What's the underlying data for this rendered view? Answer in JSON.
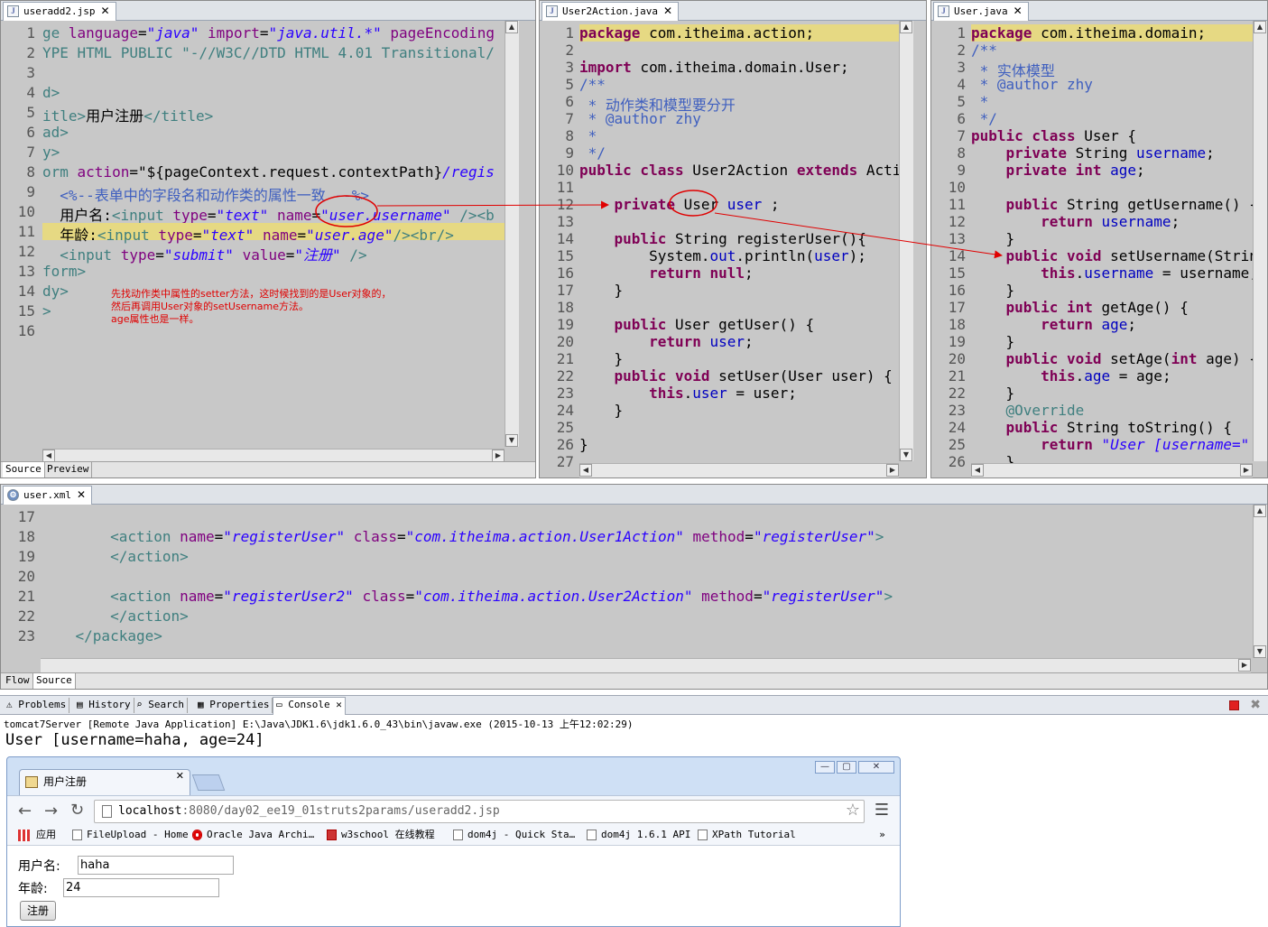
{
  "useradd": {
    "tab": "useradd2.jsp",
    "line_numbers": [
      "1",
      "2",
      "3",
      "4",
      "5",
      "6",
      "7",
      "8",
      "9",
      "10",
      "11",
      "12",
      "13",
      "14",
      "15",
      "16"
    ],
    "lines": [
      [
        {
          "t": "ge ",
          "c": "tag"
        },
        {
          "t": "language",
          "c": "attr"
        },
        {
          "t": "=",
          "c": ""
        },
        {
          "t": "\"java\"",
          "c": "str"
        },
        {
          "t": " ",
          "c": ""
        },
        {
          "t": "import",
          "c": "attr"
        },
        {
          "t": "=",
          "c": ""
        },
        {
          "t": "\"java.util.*\"",
          "c": "str"
        },
        {
          "t": " ",
          "c": ""
        },
        {
          "t": "pageEncoding",
          "c": "attr"
        }
      ],
      [
        {
          "t": "YPE HTML PUBLIC \"-//W3C//DTD HTML 4.01 Transitional/",
          "c": "tag"
        }
      ],
      [],
      [
        {
          "t": "d>",
          "c": "tag"
        }
      ],
      [
        {
          "t": "itle>",
          "c": "tag"
        },
        {
          "t": "用户注册",
          "c": ""
        },
        {
          "t": "</title>",
          "c": "tag"
        }
      ],
      [
        {
          "t": "ad>",
          "c": "tag"
        }
      ],
      [
        {
          "t": "y>",
          "c": "tag"
        }
      ],
      [
        {
          "t": "orm ",
          "c": "tag"
        },
        {
          "t": "action",
          "c": "attr"
        },
        {
          "t": "=\"${pageContext.request.contextPath}",
          "c": ""
        },
        {
          "t": "/regis",
          "c": "str"
        }
      ],
      [
        {
          "t": "  <%--表单中的字段名和动作类的属性一致 --%>",
          "c": "cm"
        }
      ],
      [
        {
          "t": "  用户名:",
          "c": ""
        },
        {
          "t": "<input ",
          "c": "tag"
        },
        {
          "t": "type",
          "c": "attr"
        },
        {
          "t": "=",
          "c": ""
        },
        {
          "t": "\"text\"",
          "c": "str"
        },
        {
          "t": " ",
          "c": ""
        },
        {
          "t": "name",
          "c": "attr"
        },
        {
          "t": "=",
          "c": ""
        },
        {
          "t": "\"user.username\"",
          "c": "str"
        },
        {
          "t": " />",
          "c": "tag"
        },
        {
          "t": "<b",
          "c": "tag"
        }
      ],
      [
        {
          "t": "  年龄:",
          "c": ""
        },
        {
          "t": "<input ",
          "c": "tag"
        },
        {
          "t": "type",
          "c": "attr"
        },
        {
          "t": "=",
          "c": ""
        },
        {
          "t": "\"text\"",
          "c": "str"
        },
        {
          "t": " ",
          "c": ""
        },
        {
          "t": "name",
          "c": "attr"
        },
        {
          "t": "=",
          "c": ""
        },
        {
          "t": "\"user.age\"",
          "c": "str"
        },
        {
          "t": "/><br/>",
          "c": "tag"
        }
      ],
      [
        {
          "t": "  <input ",
          "c": "tag"
        },
        {
          "t": "type",
          "c": "attr"
        },
        {
          "t": "=",
          "c": ""
        },
        {
          "t": "\"submit\"",
          "c": "str"
        },
        {
          "t": " ",
          "c": ""
        },
        {
          "t": "value",
          "c": "attr"
        },
        {
          "t": "=",
          "c": ""
        },
        {
          "t": "\"注册\"",
          "c": "str"
        },
        {
          "t": " />",
          "c": "tag"
        }
      ],
      [
        {
          "t": "form>",
          "c": "tag"
        }
      ],
      [
        {
          "t": "dy>",
          "c": "tag"
        }
      ],
      [
        {
          "t": ">",
          "c": "tag"
        }
      ],
      []
    ],
    "annotation": "先找动作类中属性的setter方法，这时候找到的是User对象的，\n然后再调用User对象的setUsername方法。\nage属性也是一样。",
    "bottom_tabs": [
      "Source",
      "Preview"
    ]
  },
  "action": {
    "tab": "User2Action.java",
    "line_numbers": [
      "1",
      "2",
      "3",
      "5",
      "6",
      "7",
      "8",
      "9",
      "10",
      "11",
      "12",
      "13",
      "14",
      "15",
      "16",
      "17",
      "18",
      "19",
      "20",
      "21",
      "22",
      "23",
      "24",
      "25",
      "26",
      "27"
    ],
    "lines": [
      [
        {
          "t": "package",
          "c": "kw"
        },
        {
          "t": " com.itheima.action;",
          "c": ""
        }
      ],
      [],
      [
        {
          "t": "import",
          "c": "kw"
        },
        {
          "t": " com.itheima.domain.User;",
          "c": ""
        }
      ],
      [
        {
          "t": "/**",
          "c": "cm"
        }
      ],
      [
        {
          "t": " * 动作类和模型要分开",
          "c": "cm"
        }
      ],
      [
        {
          "t": " * @author zhy",
          "c": "cm"
        }
      ],
      [
        {
          "t": " *",
          "c": "cm"
        }
      ],
      [
        {
          "t": " */",
          "c": "cm"
        }
      ],
      [
        {
          "t": "public class",
          "c": "kw"
        },
        {
          "t": " User2Action ",
          "c": ""
        },
        {
          "t": "extends",
          "c": "kw"
        },
        {
          "t": " ActionS",
          "c": ""
        }
      ],
      [],
      [
        {
          "t": "    ",
          "c": ""
        },
        {
          "t": "private",
          "c": "kw"
        },
        {
          "t": " User ",
          "c": ""
        },
        {
          "t": "user",
          "c": "fld"
        },
        {
          "t": " ;",
          "c": ""
        }
      ],
      [],
      [
        {
          "t": "    ",
          "c": ""
        },
        {
          "t": "public",
          "c": "kw"
        },
        {
          "t": " String registerUser(){",
          "c": ""
        }
      ],
      [
        {
          "t": "        System.",
          "c": ""
        },
        {
          "t": "out",
          "c": "fld"
        },
        {
          "t": ".println(",
          "c": ""
        },
        {
          "t": "user",
          "c": "fld"
        },
        {
          "t": ");",
          "c": ""
        }
      ],
      [
        {
          "t": "        ",
          "c": ""
        },
        {
          "t": "return null",
          "c": "kw"
        },
        {
          "t": ";",
          "c": ""
        }
      ],
      [
        {
          "t": "    }",
          "c": ""
        }
      ],
      [],
      [
        {
          "t": "    ",
          "c": ""
        },
        {
          "t": "public",
          "c": "kw"
        },
        {
          "t": " User getUser() {",
          "c": ""
        }
      ],
      [
        {
          "t": "        ",
          "c": ""
        },
        {
          "t": "return",
          "c": "kw"
        },
        {
          "t": " ",
          "c": ""
        },
        {
          "t": "user",
          "c": "fld"
        },
        {
          "t": ";",
          "c": ""
        }
      ],
      [
        {
          "t": "    }",
          "c": ""
        }
      ],
      [
        {
          "t": "    ",
          "c": ""
        },
        {
          "t": "public void",
          "c": "kw"
        },
        {
          "t": " setUser(User user) {",
          "c": ""
        }
      ],
      [
        {
          "t": "        ",
          "c": ""
        },
        {
          "t": "this",
          "c": "kw"
        },
        {
          "t": ".",
          "c": ""
        },
        {
          "t": "user",
          "c": "fld"
        },
        {
          "t": " = user;",
          "c": ""
        }
      ],
      [
        {
          "t": "    }",
          "c": ""
        }
      ],
      [],
      [
        {
          "t": "}",
          "c": ""
        }
      ],
      []
    ]
  },
  "user": {
    "tab": "User.java",
    "line_numbers": [
      "1",
      "2",
      "3",
      "4",
      "5",
      "6",
      "7",
      "8",
      "9",
      "10",
      "11",
      "12",
      "13",
      "14",
      "15",
      "16",
      "17",
      "18",
      "19",
      "20",
      "21",
      "22",
      "23",
      "24",
      "25",
      "26"
    ],
    "lines": [
      [
        {
          "t": "package",
          "c": "kw"
        },
        {
          "t": " com.itheima.domain;",
          "c": ""
        }
      ],
      [
        {
          "t": "/**",
          "c": "cm"
        }
      ],
      [
        {
          "t": " * 实体模型",
          "c": "cm"
        }
      ],
      [
        {
          "t": " * @author zhy",
          "c": "cm"
        }
      ],
      [
        {
          "t": " *",
          "c": "cm"
        }
      ],
      [
        {
          "t": " */",
          "c": "cm"
        }
      ],
      [
        {
          "t": "public class",
          "c": "kw"
        },
        {
          "t": " User {",
          "c": ""
        }
      ],
      [
        {
          "t": "    ",
          "c": ""
        },
        {
          "t": "private",
          "c": "kw"
        },
        {
          "t": " String ",
          "c": ""
        },
        {
          "t": "username",
          "c": "fld"
        },
        {
          "t": ";",
          "c": ""
        }
      ],
      [
        {
          "t": "    ",
          "c": ""
        },
        {
          "t": "private int",
          "c": "kw"
        },
        {
          "t": " ",
          "c": ""
        },
        {
          "t": "age",
          "c": "fld"
        },
        {
          "t": ";",
          "c": ""
        }
      ],
      [],
      [
        {
          "t": "    ",
          "c": ""
        },
        {
          "t": "public",
          "c": "kw"
        },
        {
          "t": " String getUsername() {",
          "c": ""
        }
      ],
      [
        {
          "t": "        ",
          "c": ""
        },
        {
          "t": "return",
          "c": "kw"
        },
        {
          "t": " ",
          "c": ""
        },
        {
          "t": "username",
          "c": "fld"
        },
        {
          "t": ";",
          "c": ""
        }
      ],
      [
        {
          "t": "    }",
          "c": ""
        }
      ],
      [
        {
          "t": "    ",
          "c": ""
        },
        {
          "t": "public void",
          "c": "kw"
        },
        {
          "t": " setUsername(String",
          "c": ""
        }
      ],
      [
        {
          "t": "        ",
          "c": ""
        },
        {
          "t": "this",
          "c": "kw"
        },
        {
          "t": ".",
          "c": ""
        },
        {
          "t": "username",
          "c": "fld"
        },
        {
          "t": " = username;",
          "c": ""
        }
      ],
      [
        {
          "t": "    }",
          "c": ""
        }
      ],
      [
        {
          "t": "    ",
          "c": ""
        },
        {
          "t": "public int",
          "c": "kw"
        },
        {
          "t": " getAge() {",
          "c": ""
        }
      ],
      [
        {
          "t": "        ",
          "c": ""
        },
        {
          "t": "return",
          "c": "kw"
        },
        {
          "t": " ",
          "c": ""
        },
        {
          "t": "age",
          "c": "fld"
        },
        {
          "t": ";",
          "c": ""
        }
      ],
      [
        {
          "t": "    }",
          "c": ""
        }
      ],
      [
        {
          "t": "    ",
          "c": ""
        },
        {
          "t": "public void",
          "c": "kw"
        },
        {
          "t": " setAge(",
          "c": ""
        },
        {
          "t": "int",
          "c": "kw"
        },
        {
          "t": " age) {",
          "c": ""
        }
      ],
      [
        {
          "t": "        ",
          "c": ""
        },
        {
          "t": "this",
          "c": "kw"
        },
        {
          "t": ".",
          "c": ""
        },
        {
          "t": "age",
          "c": "fld"
        },
        {
          "t": " = age;",
          "c": ""
        }
      ],
      [
        {
          "t": "    }",
          "c": ""
        }
      ],
      [
        {
          "t": "    @Override",
          "c": "tag"
        }
      ],
      [
        {
          "t": "    ",
          "c": ""
        },
        {
          "t": "public",
          "c": "kw"
        },
        {
          "t": " String toString() {",
          "c": ""
        }
      ],
      [
        {
          "t": "        ",
          "c": ""
        },
        {
          "t": "return",
          "c": "kw"
        },
        {
          "t": " ",
          "c": ""
        },
        {
          "t": "\"User [username=\"",
          "c": "str"
        },
        {
          "t": " +",
          "c": ""
        }
      ],
      [
        {
          "t": "    }",
          "c": ""
        }
      ]
    ]
  },
  "xml": {
    "tab": "user.xml",
    "line_numbers": [
      "17",
      "18",
      "19",
      "20",
      "21",
      "22",
      "23"
    ],
    "lines": [
      [],
      [
        {
          "t": "        <action ",
          "c": "tag"
        },
        {
          "t": "name",
          "c": "attr"
        },
        {
          "t": "=",
          "c": ""
        },
        {
          "t": "\"registerUser\"",
          "c": "str"
        },
        {
          "t": " ",
          "c": ""
        },
        {
          "t": "class",
          "c": "attr"
        },
        {
          "t": "=",
          "c": ""
        },
        {
          "t": "\"com.itheima.action.User1Action\"",
          "c": "str"
        },
        {
          "t": " ",
          "c": ""
        },
        {
          "t": "method",
          "c": "attr"
        },
        {
          "t": "=",
          "c": ""
        },
        {
          "t": "\"registerUser\"",
          "c": "str"
        },
        {
          "t": ">",
          "c": "tag"
        }
      ],
      [
        {
          "t": "        </action>",
          "c": "tag"
        }
      ],
      [],
      [
        {
          "t": "        <action ",
          "c": "tag"
        },
        {
          "t": "name",
          "c": "attr"
        },
        {
          "t": "=",
          "c": ""
        },
        {
          "t": "\"registerUser2\"",
          "c": "str"
        },
        {
          "t": " ",
          "c": ""
        },
        {
          "t": "class",
          "c": "attr"
        },
        {
          "t": "=",
          "c": ""
        },
        {
          "t": "\"com.itheima.action.User2Action\"",
          "c": "str"
        },
        {
          "t": " ",
          "c": ""
        },
        {
          "t": "method",
          "c": "attr"
        },
        {
          "t": "=",
          "c": ""
        },
        {
          "t": "\"registerUser\"",
          "c": "str"
        },
        {
          "t": ">",
          "c": "tag"
        }
      ],
      [
        {
          "t": "        </action>",
          "c": "tag"
        }
      ],
      [
        {
          "t": "    </package>",
          "c": "tag"
        }
      ]
    ],
    "bottom_tabs": [
      "Flow",
      "Source"
    ]
  },
  "console": {
    "tabs": [
      "Problems",
      "History",
      "Search",
      "Properties",
      "Console"
    ],
    "launch": "tomcat7Server [Remote Java Application] E:\\Java\\JDK1.6\\jdk1.6.0_43\\bin\\javaw.exe (2015-10-13 上午12:02:29)",
    "output": "User [username=haha, age=24]"
  },
  "browser": {
    "tab_title": "用户注册",
    "url_host": "localhost",
    "url_rest": ":8080/day02_ee19_01struts2params/useradd2.jsp",
    "bookmarks": [
      "应用",
      "FileUpload - Home",
      "Oracle Java Archi…",
      "w3school 在线教程",
      "dom4j - Quick Sta…",
      "dom4j 1.6.1 API",
      "XPath Tutorial"
    ],
    "form": {
      "username_label": "用户名:",
      "username_value": "haha",
      "age_label": "年龄:",
      "age_value": "24",
      "submit_label": "注册"
    }
  },
  "colors": {
    "keyword": "#7f0055",
    "string": "#2a00ff",
    "field": "#0000c0",
    "comment": "#3f5fbf",
    "tag": "#3f7f7f",
    "annotation": "#e00000",
    "highlight": "#e6d983"
  }
}
